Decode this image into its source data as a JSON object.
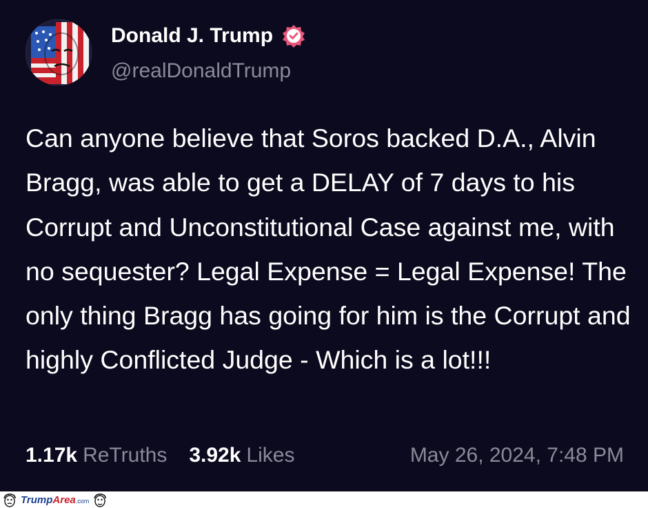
{
  "post": {
    "author": {
      "name": "Donald J. Trump",
      "handle": "@realDonaldTrump",
      "avatar_icon": "flag-portrait-avatar",
      "verified_icon": "verified-badge-icon",
      "verified_color": "#e8567a"
    },
    "body": "Can anyone believe that Soros backed D.A., Alvin Bragg, was able to get a DELAY of 7 days to his Corrupt and Unconstitutional Case against me, with no sequester? Legal Expense = Legal Expense! The only thing Bragg has going for him is the Corrupt and highly Conflicted Judge - Which is a lot!!!",
    "retruths": {
      "count": "1.17k",
      "label": "ReTruths"
    },
    "likes": {
      "count": "3.92k",
      "label": "Likes"
    },
    "timestamp": "May 26, 2024, 7:48 PM"
  },
  "watermark": {
    "brand_part1": "Trump",
    "brand_part2": "Area",
    "brand_suffix": ".com",
    "brand_colors": {
      "blue": "#1b3f8f",
      "red": "#c8232c"
    }
  },
  "colors": {
    "background": "#0c0a1e",
    "text": "#ffffff",
    "muted": "#8b8a99"
  }
}
